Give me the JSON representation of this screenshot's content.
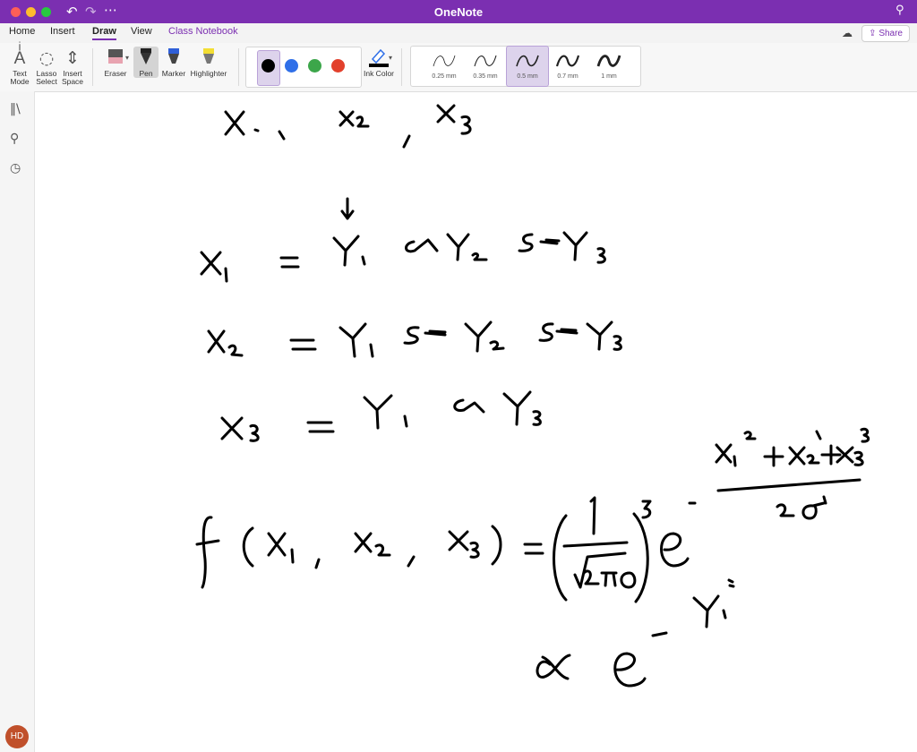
{
  "window": {
    "title": "OneNote",
    "colors": {
      "brand": "#7b2fb1",
      "ink": "#000000"
    }
  },
  "menu": {
    "tabs": [
      "Home",
      "Insert",
      "Draw",
      "View",
      "Class Notebook"
    ],
    "active_tab": "Draw",
    "share_label": "Share"
  },
  "ribbon": {
    "tools": {
      "text_mode": "Text Mode",
      "lasso_select": "Lasso Select",
      "insert_space": "Insert Space",
      "eraser": "Eraser",
      "pen": "Pen",
      "marker": "Marker",
      "highlighter": "Highlighter",
      "ink_color": "Ink Color"
    },
    "pen_colors": [
      "#000000",
      "#2f6fe8",
      "#3ca64a",
      "#e2402c"
    ],
    "selected_color_index": 0,
    "thickness": [
      "0.25 mm",
      "0.35 mm",
      "0.5 mm",
      "0.7 mm",
      "1 mm"
    ],
    "selected_thickness": "0.5 mm"
  },
  "sidebar": {
    "icons": [
      "notebooks-icon",
      "search-icon",
      "recent-icon"
    ],
    "avatar_initials": "HD"
  }
}
